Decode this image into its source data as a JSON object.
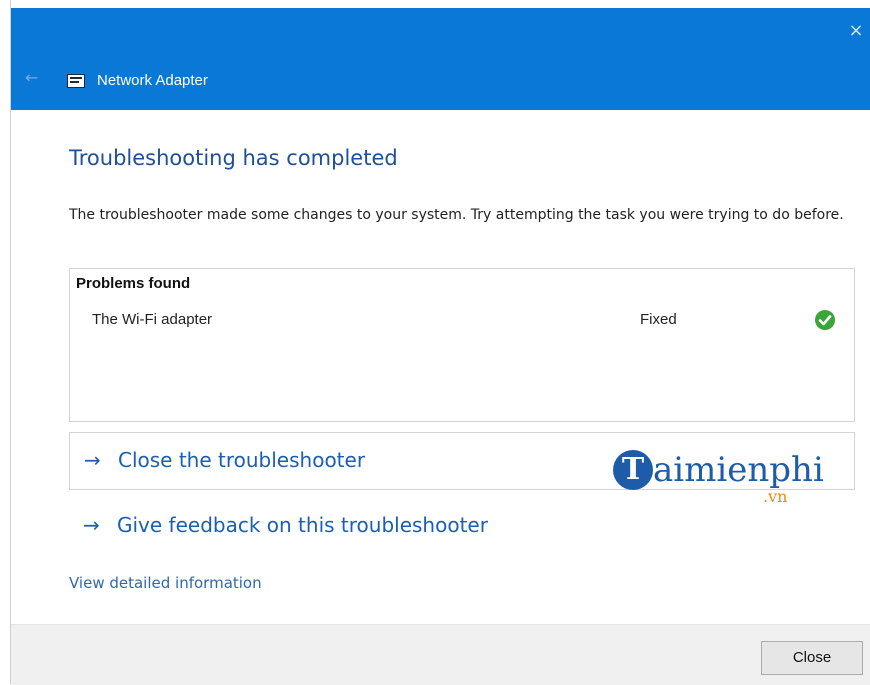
{
  "window": {
    "title": "Network Adapter",
    "back_glyph": "←",
    "close_glyph": "×"
  },
  "main": {
    "heading": "Troubleshooting has completed",
    "description": "The troubleshooter made some changes to your system. Try attempting the task you were trying to do before.",
    "problems": {
      "header": "Problems found",
      "items": [
        {
          "name": "The Wi-Fi adapter",
          "status": "Fixed",
          "status_icon": "green-check-icon"
        }
      ]
    },
    "actions": [
      {
        "arrow": "→",
        "label": "Close the troubleshooter"
      },
      {
        "arrow": "→",
        "label": "Give feedback on this troubleshooter"
      }
    ],
    "details_link": "View detailed information"
  },
  "watermark": {
    "initial": "T",
    "text": "aimienphi",
    "sub": ".vn"
  },
  "footer": {
    "close_label": "Close"
  },
  "colors": {
    "titlebar": "#0a78d7",
    "heading": "#1f4f98",
    "link": "#1a5fb4",
    "check": "#3aa63a"
  }
}
